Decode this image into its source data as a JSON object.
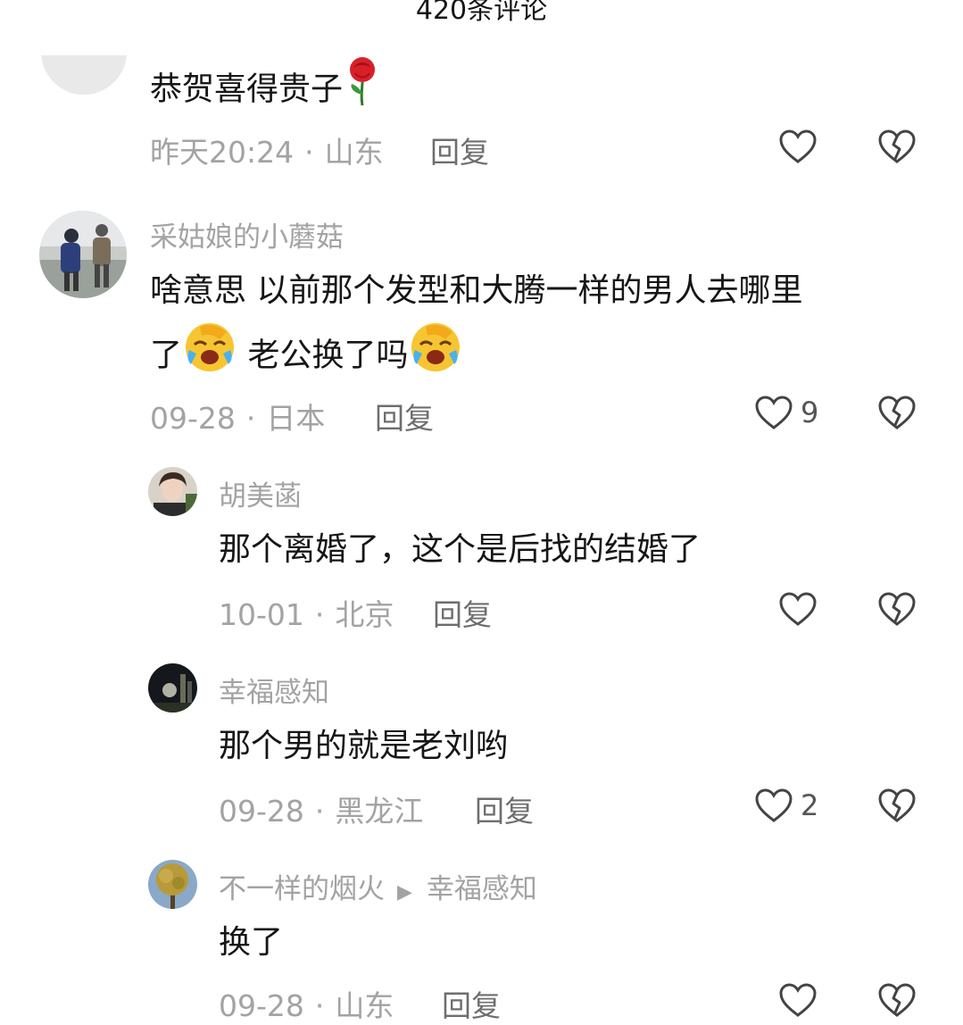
{
  "header": {
    "title": "420条评论"
  },
  "comments": [
    {
      "username": "",
      "text": "恭贺喜得贵子",
      "time": "昨天20:24",
      "location": "山东",
      "reply_label": "回复",
      "likes": "",
      "emoji": "rose"
    },
    {
      "username": "采姑娘的小蘑菇",
      "text_line1": "啥意思 以前那个发型和大腾一样的男人去哪里",
      "text_line2a": "了",
      "text_line2b": " 老公换了吗",
      "time": "09-28",
      "location": "日本",
      "reply_label": "回复",
      "likes": "9"
    },
    {
      "username": "胡美菡",
      "text": "那个离婚了，这个是后找的结婚了",
      "time": "10-01",
      "location": "北京",
      "reply_label": "回复",
      "likes": ""
    },
    {
      "username": "幸福感知",
      "text": "那个男的就是老刘哟",
      "time": "09-28",
      "location": "黑龙江",
      "reply_label": "回复",
      "likes": "2"
    },
    {
      "username": "不一样的烟火",
      "reply_to": "幸福感知",
      "text": "换了",
      "time": "09-28",
      "location": "山东",
      "reply_label": "回复",
      "likes": ""
    }
  ],
  "icons": {
    "like": "heart-outline-icon",
    "dislike": "broken-heart-icon",
    "reply_arrow": "play-triangle-icon"
  },
  "colors": {
    "text": "#161616",
    "muted": "#a3a3a3",
    "reply": "#6e6e6e"
  }
}
